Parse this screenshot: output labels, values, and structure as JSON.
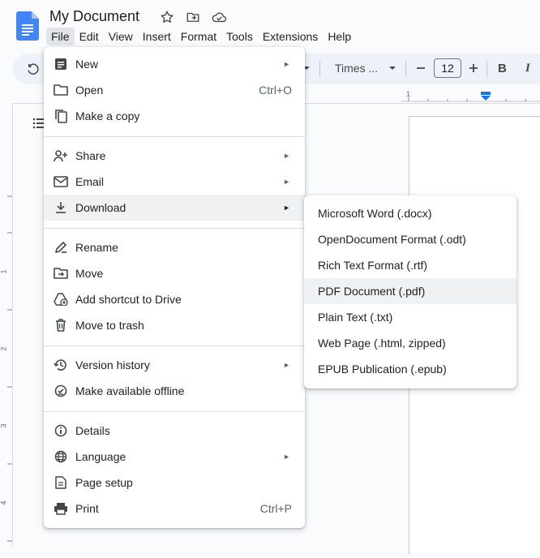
{
  "document": {
    "title": "My Document"
  },
  "menubar": [
    "File",
    "Edit",
    "View",
    "Insert",
    "Format",
    "Tools",
    "Extensions",
    "Help"
  ],
  "toolbar": {
    "font_name": "Times ...",
    "font_size": "12",
    "bold": "B",
    "italic": "I"
  },
  "ruler": {
    "h_mark": "1",
    "v_marks": [
      "1",
      "2",
      "3",
      "4"
    ]
  },
  "file_menu": {
    "items": [
      {
        "label": "New",
        "icon": "doc-icon",
        "submenu": true
      },
      {
        "label": "Open",
        "icon": "folder-icon",
        "shortcut": "Ctrl+O"
      },
      {
        "label": "Make a copy",
        "icon": "copy-icon"
      },
      {
        "label": "Share",
        "icon": "person-add-icon",
        "submenu": true
      },
      {
        "label": "Email",
        "icon": "mail-icon",
        "submenu": true
      },
      {
        "label": "Download",
        "icon": "download-icon",
        "submenu": true,
        "highlighted": true
      },
      {
        "label": "Rename",
        "icon": "rename-icon"
      },
      {
        "label": "Move",
        "icon": "move-folder-icon"
      },
      {
        "label": "Add shortcut to Drive",
        "icon": "drive-shortcut-icon"
      },
      {
        "label": "Move to trash",
        "icon": "trash-icon"
      },
      {
        "label": "Version history",
        "icon": "history-icon",
        "submenu": true
      },
      {
        "label": "Make available offline",
        "icon": "offline-icon"
      },
      {
        "label": "Details",
        "icon": "info-icon"
      },
      {
        "label": "Language",
        "icon": "globe-icon",
        "submenu": true
      },
      {
        "label": "Page setup",
        "icon": "page-icon"
      },
      {
        "label": "Print",
        "icon": "print-icon",
        "shortcut": "Ctrl+P"
      }
    ]
  },
  "download_menu": {
    "items": [
      {
        "label": "Microsoft Word (.docx)"
      },
      {
        "label": "OpenDocument Format (.odt)"
      },
      {
        "label": "Rich Text Format (.rtf)"
      },
      {
        "label": "PDF Document (.pdf)",
        "highlighted": true
      },
      {
        "label": "Plain Text (.txt)"
      },
      {
        "label": "Web Page (.html, zipped)"
      },
      {
        "label": "EPUB Publication (.epub)"
      }
    ]
  },
  "colors": {
    "docs_blue": "#4285f4",
    "icon_gray": "#444746",
    "highlight": "#eff1f3"
  }
}
